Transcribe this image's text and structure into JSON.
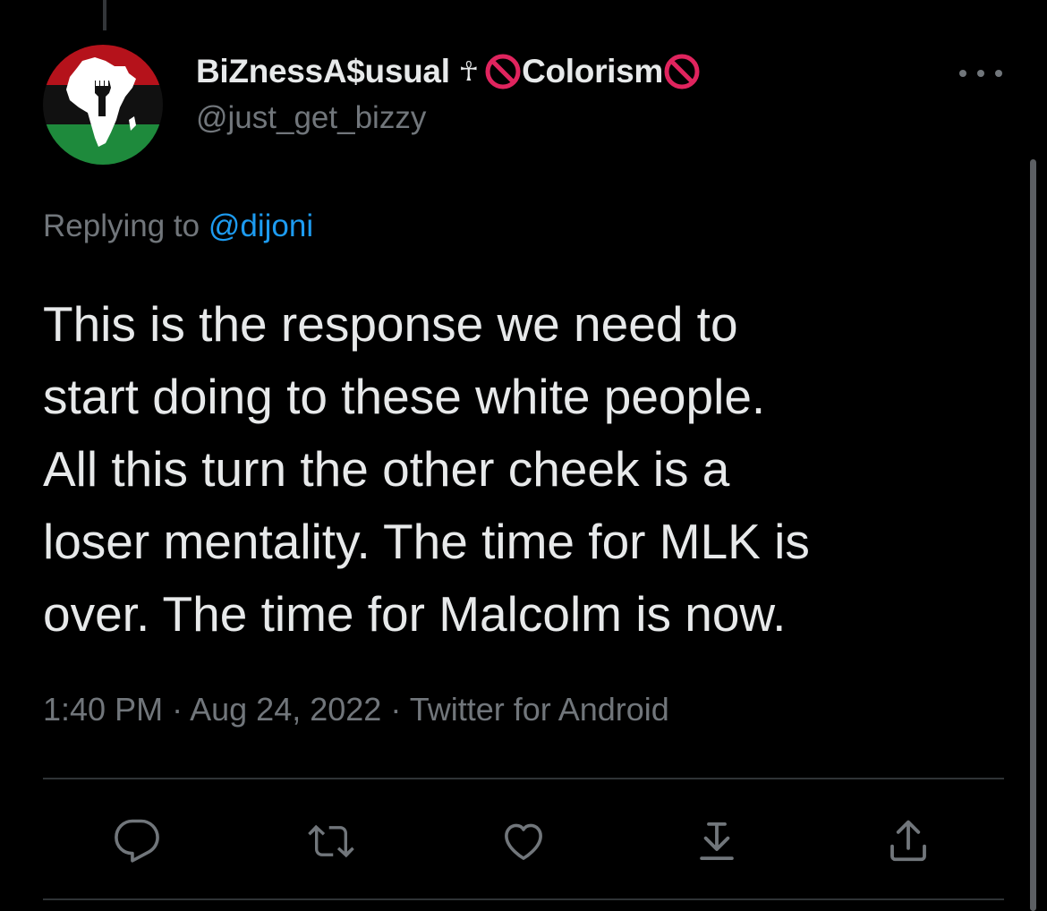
{
  "tweet": {
    "display_name": "BiZnessA$usual",
    "name_ankh": "☥",
    "name_suffix": "Colorism",
    "handle": "@just_get_bizzy",
    "reply_prefix": "Replying to",
    "reply_mention": "@dijoni",
    "text": "This is the response we need to\nstart doing to these white people.\nAll this turn the other cheek is a\nloser mentality. The time for MLK is\nover. The time for Malcolm is now.",
    "time": "1:40 PM",
    "separator": "·",
    "date": "Aug 24, 2022",
    "source": "Twitter for Android"
  },
  "colors": {
    "background": "#000000",
    "text_primary": "#e7e9ea",
    "text_secondary": "#71767b",
    "link": "#1d9bf0",
    "divider": "#2f3336",
    "prohibited_red": "#e0245e",
    "avatar_red": "#b5121b",
    "avatar_black": "#111111",
    "avatar_green": "#1e8a3c"
  },
  "icons": {
    "avatar": "pan-african-flag-africa-fist-avatar",
    "more": "more-horizontal-icon",
    "prohibited": "prohibited-icon",
    "reply": "reply-icon",
    "retweet": "retweet-icon",
    "like": "heart-icon",
    "bookmark": "bookmark-arrow-icon",
    "share": "share-icon"
  }
}
